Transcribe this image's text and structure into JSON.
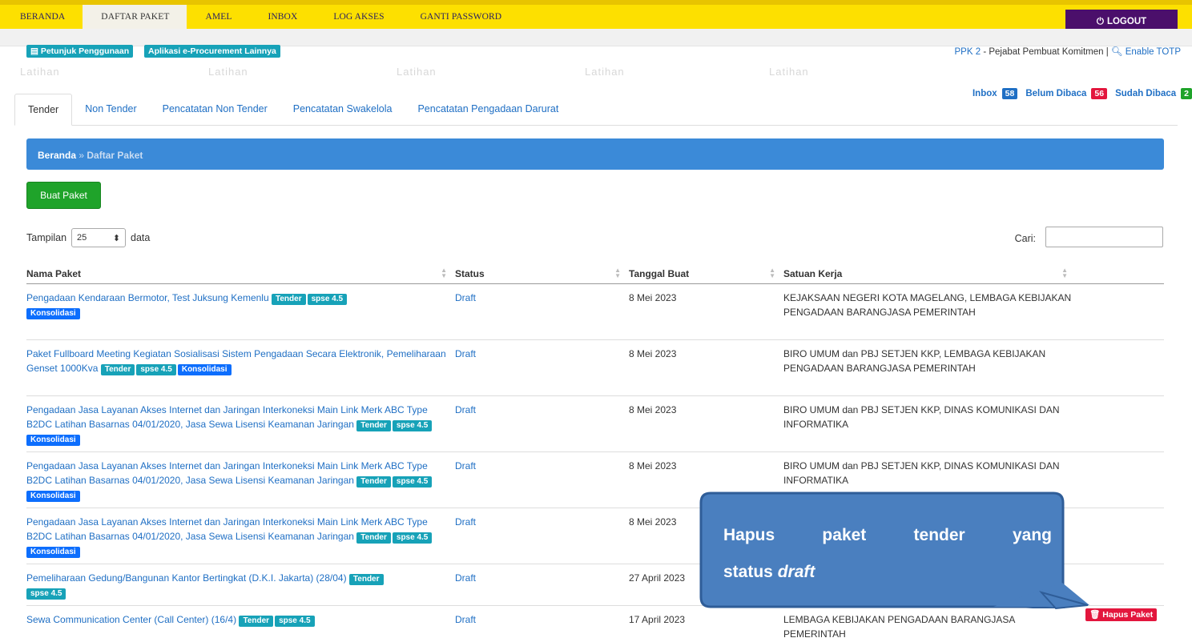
{
  "topnav": {
    "items": [
      "BERANDA",
      "DAFTAR PAKET",
      "AMEL",
      "INBOX",
      "LOG AKSES",
      "GANTI PASSWORD"
    ],
    "logout": "LOGOUT"
  },
  "links": {
    "petunjuk": "Petunjuk Penggunaan",
    "aplikasi": "Aplikasi e-Procurement Lainnya"
  },
  "user": {
    "role_link": "PPK 2",
    "role_text": " - Pejabat Pembuat Komitmen | ",
    "totp": "Enable TOTP"
  },
  "watermark": "Latihan",
  "inbox": {
    "inbox_label": "Inbox",
    "inbox_count": "58",
    "unread_label": "Belum Dibaca",
    "unread_count": "56",
    "read_label": "Sudah Dibaca",
    "read_count": "2"
  },
  "tabs": [
    "Tender",
    "Non Tender",
    "Pencatatan Non Tender",
    "Pencatatan Swakelola",
    "Pencatatan Pengadaan Darurat"
  ],
  "breadcrumb": {
    "home": "Beranda",
    "sep": " » ",
    "current": "Daftar Paket"
  },
  "buat_paket": "Buat Paket",
  "tampilan": {
    "label": "Tampilan",
    "value": "25",
    "suffix": "data"
  },
  "cari": "Cari:",
  "table": {
    "headers": [
      "Nama Paket",
      "Status",
      "Tanggal Buat",
      "Satuan Kerja"
    ],
    "rows": [
      {
        "name": "Pengadaan Kendaraan Bermotor, Test Juksung Kemenlu",
        "tags": [
          "Tender",
          "spse 4.5",
          "Konsolidasi"
        ],
        "status": "Draft",
        "date": "8 Mei 2023",
        "satker": "KEJAKSAAN NEGERI KOTA MAGELANG, LEMBAGA KEBIJAKAN PENGADAAN BARANGJASA PEMERINTAH"
      },
      {
        "name": "Paket Fullboard Meeting Kegiatan Sosialisasi Sistem Pengadaan Secara Elektronik, Pemeliharaan Genset 1000Kva",
        "tags": [
          "Tender",
          "spse 4.5",
          "Konsolidasi"
        ],
        "status": "Draft",
        "date": "8 Mei 2023",
        "satker": "BIRO UMUM dan PBJ SETJEN KKP, LEMBAGA KEBIJAKAN PENGADAAN BARANGJASA PEMERINTAH"
      },
      {
        "name": "Pengadaan Jasa Layanan Akses Internet dan Jaringan Interkoneksi Main Link Merk ABC Type B2DC Latihan Basarnas 04/01/2020, Jasa Sewa Lisensi Keamanan Jaringan",
        "tags": [
          "Tender",
          "spse 4.5",
          "Konsolidasi"
        ],
        "status": "Draft",
        "date": "8 Mei 2023",
        "satker": "BIRO UMUM dan PBJ SETJEN KKP, DINAS KOMUNIKASI DAN INFORMATIKA"
      },
      {
        "name": "Pengadaan Jasa Layanan Akses Internet dan Jaringan Interkoneksi Main Link Merk ABC Type B2DC Latihan Basarnas 04/01/2020, Jasa Sewa Lisensi Keamanan Jaringan",
        "tags": [
          "Tender",
          "spse 4.5",
          "Konsolidasi"
        ],
        "status": "Draft",
        "date": "8 Mei 2023",
        "satker": "BIRO UMUM dan PBJ SETJEN KKP, DINAS KOMUNIKASI DAN INFORMATIKA"
      },
      {
        "name": "Pengadaan Jasa Layanan Akses Internet dan Jaringan Interkoneksi Main Link Merk ABC Type B2DC Latihan Basarnas 04/01/2020, Jasa Sewa Lisensi Keamanan Jaringan",
        "tags": [
          "Tender",
          "spse 4.5",
          "Konsolidasi"
        ],
        "status": "Draft",
        "date": "8 Mei 2023",
        "satker": ""
      },
      {
        "name": "Pemeliharaan Gedung/Bangunan Kantor Bertingkat (D.K.I. Jakarta) (28/04)",
        "tags": [
          "Tender",
          "spse 4.5"
        ],
        "status": "Draft",
        "date": "27 April 2023",
        "satker": ""
      },
      {
        "name": "Sewa Communication Center (Call Center) (16/4)",
        "tags": [
          "Tender",
          "spse 4.5"
        ],
        "status": "Draft",
        "date": "17 April 2023",
        "satker": "LEMBAGA KEBIJAKAN PENGADAAN BARANGJASA PEMERINTAH"
      }
    ]
  },
  "hapus_paket": "Hapus Paket",
  "callout": {
    "line1": "Hapus paket tender yang",
    "line2_prefix": "status ",
    "line2_em": "draft"
  },
  "colors": {
    "nav_bg": "#fde000",
    "logout_bg": "#4b0f6b",
    "crumb_bg": "#3b8ad8",
    "btn_green": "#1fa32a",
    "tag_teal": "#17a2b8",
    "tag_blue": "#0d6efd",
    "danger": "#e3163d",
    "callout_fill": "#4a7fbf"
  },
  "icons": {
    "logout": "power-icon",
    "petunjuk": "book-icon",
    "totp": "key-icon",
    "hapus": "trash-icon"
  }
}
